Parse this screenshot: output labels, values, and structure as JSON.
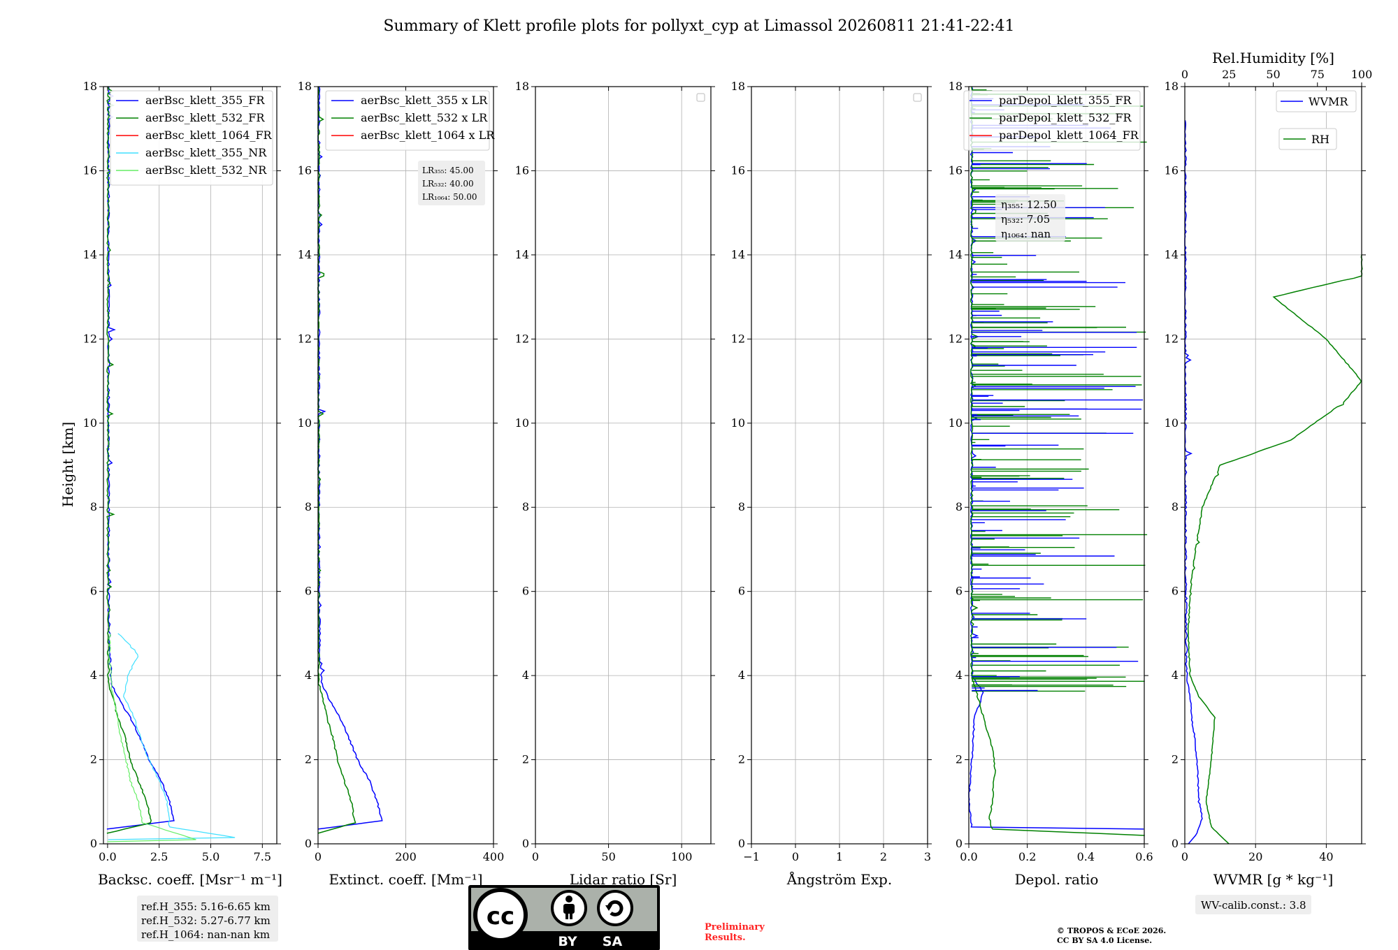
{
  "title": "Summary of Klett profile plots for pollyxt_cyp at Limassol 20260811 21:41-22:41",
  "y_label": "Height [km]",
  "colors": {
    "blue": "#0000ff",
    "green": "#008000",
    "red": "#ff0000",
    "cyan": "#40e0ff",
    "lightgreen": "#66ee66"
  },
  "chart_data": [
    {
      "type": "line",
      "id": "backscatter",
      "xlabel": "Backsc. coeff. [Msr⁻¹ m⁻¹]",
      "xlim": [
        -0.2,
        8.2
      ],
      "ylim": [
        0,
        18
      ],
      "xticks": [
        "0.0",
        "2.5",
        "5.0",
        "7.5"
      ],
      "xtick_values": [
        0,
        2.5,
        5,
        7.5
      ],
      "yticks": [
        "0",
        "2",
        "4",
        "6",
        "8",
        "10",
        "12",
        "14",
        "16",
        "18"
      ],
      "legend": [
        "aerBsc_klett_355_FR",
        "aerBsc_klett_532_FR",
        "aerBsc_klett_1064_FR",
        "aerBsc_klett_355_NR",
        "aerBsc_klett_532_NR"
      ],
      "legend_colors": [
        "blue",
        "green",
        "red",
        "cyan",
        "lightgreen"
      ],
      "legend_position": "upper-right",
      "series": [
        {
          "name": "aerBsc_klett_355_FR",
          "color": "blue",
          "points": [
            [
              0,
              0.35
            ],
            [
              3.2,
              0.55
            ],
            [
              3.0,
              1.0
            ],
            [
              2.6,
              1.5
            ],
            [
              2.0,
              2.0
            ],
            [
              1.5,
              2.6
            ],
            [
              1.1,
              3.0
            ],
            [
              0.6,
              3.4
            ],
            [
              0.2,
              3.8
            ],
            [
              0.1,
              4.5
            ],
            [
              0.05,
              6
            ],
            [
              0.05,
              10
            ],
            [
              0.05,
              14
            ],
            [
              0.05,
              18
            ]
          ]
        },
        {
          "name": "aerBsc_klett_532_FR",
          "color": "green",
          "points": [
            [
              0,
              0.25
            ],
            [
              2.1,
              0.5
            ],
            [
              1.9,
              1.0
            ],
            [
              1.5,
              1.5
            ],
            [
              1.1,
              2.0
            ],
            [
              0.8,
              2.6
            ],
            [
              0.5,
              3.0
            ],
            [
              0.25,
              3.5
            ],
            [
              0.05,
              3.8
            ],
            [
              0.02,
              6
            ],
            [
              0.02,
              10
            ],
            [
              0.02,
              14
            ],
            [
              0.02,
              18
            ]
          ]
        },
        {
          "name": "aerBsc_klett_355_NR",
          "color": "cyan",
          "points": [
            [
              0,
              0.1
            ],
            [
              6.2,
              0.15
            ],
            [
              3.0,
              0.4
            ],
            [
              2.9,
              1.0
            ],
            [
              2.5,
              1.5
            ],
            [
              2.0,
              2.0
            ],
            [
              1.6,
              2.5
            ],
            [
              1.3,
              3.0
            ],
            [
              0.8,
              3.5
            ],
            [
              1.0,
              4.0
            ],
            [
              1.5,
              4.5
            ],
            [
              0.5,
              5.0
            ]
          ]
        },
        {
          "name": "aerBsc_klett_532_NR",
          "color": "lightgreen",
          "points": [
            [
              0,
              0.05
            ],
            [
              4.3,
              0.1
            ],
            [
              1.7,
              0.5
            ],
            [
              1.5,
              1.0
            ],
            [
              1.1,
              1.5
            ],
            [
              0.9,
              2.0
            ],
            [
              0.6,
              2.6
            ],
            [
              0.4,
              3.2
            ],
            [
              0.2,
              3.7
            ],
            [
              0.1,
              4.5
            ],
            [
              0.1,
              5.0
            ]
          ]
        }
      ],
      "annotation": [
        "ref.H_355: 5.16-6.65 km",
        "ref.H_532: 5.27-6.77 km",
        "ref.H_1064: nan-nan km"
      ]
    },
    {
      "type": "line",
      "id": "extinction",
      "xlabel": "Extinct. coeff. [Mm⁻¹]",
      "xlim": [
        0,
        400
      ],
      "ylim": [
        0,
        18
      ],
      "xticks": [
        "0",
        "200",
        "400"
      ],
      "xtick_values": [
        0,
        200,
        400
      ],
      "yticks": [
        "0",
        "2",
        "4",
        "6",
        "8",
        "10",
        "12",
        "14",
        "16",
        "18"
      ],
      "legend": [
        "aerBsc_klett_355 x LR",
        "aerBsc_klett_532 x LR",
        "aerBsc_klett_1064 x LR"
      ],
      "legend_colors": [
        "blue",
        "green",
        "red"
      ],
      "legend_position": "upper-right",
      "series": [
        {
          "name": "aerBsc_klett_355 x LR",
          "color": "blue",
          "points": [
            [
              0,
              0.35
            ],
            [
              145,
              0.55
            ],
            [
              135,
              1.0
            ],
            [
              117,
              1.5
            ],
            [
              90,
              2.0
            ],
            [
              67,
              2.6
            ],
            [
              50,
              3.0
            ],
            [
              27,
              3.4
            ],
            [
              9,
              3.8
            ],
            [
              4,
              4.5
            ],
            [
              2,
              6
            ],
            [
              2,
              10
            ],
            [
              2,
              14
            ],
            [
              2,
              18
            ]
          ]
        },
        {
          "name": "aerBsc_klett_532 x LR",
          "color": "green",
          "points": [
            [
              0,
              0.25
            ],
            [
              84,
              0.5
            ],
            [
              76,
              1.0
            ],
            [
              60,
              1.5
            ],
            [
              44,
              2.0
            ],
            [
              32,
              2.6
            ],
            [
              20,
              3.0
            ],
            [
              10,
              3.5
            ],
            [
              2,
              3.8
            ],
            [
              1,
              6
            ],
            [
              1,
              10
            ],
            [
              1,
              14
            ],
            [
              1,
              18
            ]
          ]
        }
      ],
      "annotation": [
        "LR₃₅₅: 45.00",
        "LR₅₃₂: 40.00",
        "LR₁₀₆₄: 50.00"
      ]
    },
    {
      "type": "line",
      "id": "lidar-ratio",
      "xlabel": "Lidar ratio [Sr]",
      "xlim": [
        0,
        120
      ],
      "ylim": [
        0,
        18
      ],
      "xticks": [
        "0",
        "50",
        "100"
      ],
      "xtick_values": [
        0,
        50,
        100
      ],
      "yticks": [
        "0",
        "2",
        "4",
        "6",
        "8",
        "10",
        "12",
        "14",
        "16",
        "18"
      ],
      "series": []
    },
    {
      "type": "line",
      "id": "angstrom",
      "xlabel": "Ångström Exp.",
      "xlim": [
        -1,
        3
      ],
      "ylim": [
        0,
        18
      ],
      "xticks": [
        "−1",
        "0",
        "1",
        "2",
        "3"
      ],
      "xtick_values": [
        -1,
        0,
        1,
        2,
        3
      ],
      "yticks": [
        "0",
        "2",
        "4",
        "6",
        "8",
        "10",
        "12",
        "14",
        "16",
        "18"
      ],
      "series": []
    },
    {
      "type": "line",
      "id": "depol",
      "xlabel": "Depol. ratio",
      "xlim": [
        0,
        0.6
      ],
      "ylim": [
        0,
        18
      ],
      "xticks": [
        "0.0",
        "0.2",
        "0.4",
        "0.6"
      ],
      "xtick_values": [
        0,
        0.2,
        0.4,
        0.6
      ],
      "yticks": [
        "0",
        "2",
        "4",
        "6",
        "8",
        "10",
        "12",
        "14",
        "16",
        "18"
      ],
      "legend": [
        "parDepol_klett_355_FR",
        "parDepol_klett_532_FR",
        "parDepol_klett_1064_FR"
      ],
      "legend_colors": [
        "blue",
        "green",
        "red"
      ],
      "legend_position": "upper-right",
      "series": [
        {
          "name": "parDepol_klett_355_FR",
          "color": "blue",
          "points": [
            [
              0.6,
              0.35
            ],
            [
              0.01,
              0.4
            ],
            [
              0.0,
              1.0
            ],
            [
              0.01,
              2.0
            ],
            [
              0.02,
              3.0
            ],
            [
              0.05,
              3.6
            ],
            [
              0.01,
              4.0
            ],
            [
              0.01,
              6
            ],
            [
              0.01,
              10
            ],
            [
              0.01,
              14
            ],
            [
              0.01,
              18
            ]
          ]
        },
        {
          "name": "parDepol_klett_532_FR",
          "color": "green",
          "points": [
            [
              0.6,
              0.2
            ],
            [
              0.08,
              0.35
            ],
            [
              0.07,
              0.6
            ],
            [
              0.08,
              1.0
            ],
            [
              0.09,
              1.8
            ],
            [
              0.08,
              2.3
            ],
            [
              0.05,
              3.0
            ],
            [
              0.03,
              3.5
            ],
            [
              0.01,
              4.0
            ],
            [
              0.01,
              6
            ],
            [
              0.01,
              10
            ],
            [
              0.01,
              14
            ],
            [
              0.01,
              18
            ]
          ]
        }
      ],
      "spikes": {
        "blue_max": 0.6,
        "green_max": 0.6,
        "from": 3.5,
        "to": 18
      },
      "annotation": [
        "η₃₅₅: 12.50",
        "η₅₃₂: 7.05",
        "η₁₀₆₄: nan"
      ]
    },
    {
      "type": "line",
      "id": "wvmr",
      "xlabel": "WVMR [g * kg⁻¹]",
      "xlim": [
        0,
        50
      ],
      "ylim": [
        0,
        18
      ],
      "xticks": [
        "0",
        "20",
        "40"
      ],
      "xtick_values": [
        0,
        20,
        40
      ],
      "yticks": [
        "0",
        "2",
        "4",
        "6",
        "8",
        "10",
        "12",
        "14",
        "16",
        "18"
      ],
      "top_xlabel": "Rel.Humidity [%]",
      "top_xlim": [
        0,
        100
      ],
      "top_xticks": [
        "0",
        "25",
        "50",
        "75",
        "100"
      ],
      "top_xtick_values": [
        0,
        25,
        50,
        75,
        100
      ],
      "legend": [
        "WVMR",
        "RH"
      ],
      "legend_colors": [
        "blue",
        "green"
      ],
      "legend_position": "upper-right",
      "series": [
        {
          "name": "WVMR",
          "color": "blue",
          "points": [
            [
              1,
              0
            ],
            [
              3,
              0.2
            ],
            [
              5,
              0.6
            ],
            [
              4,
              1.0
            ],
            [
              3.5,
              2.0
            ],
            [
              2,
              3.0
            ],
            [
              1.5,
              3.5
            ],
            [
              0.5,
              4.0
            ],
            [
              0.3,
              6
            ],
            [
              0.2,
              8
            ],
            [
              0.2,
              10
            ],
            [
              0.1,
              12
            ],
            [
              0.1,
              14
            ],
            [
              0.1,
              17.2
            ]
          ]
        },
        {
          "name": "RH",
          "color": "green",
          "axis": "top",
          "points": [
            [
              25,
              0
            ],
            [
              15,
              0.4
            ],
            [
              12,
              1.0
            ],
            [
              15,
              2.0
            ],
            [
              17,
              3.0
            ],
            [
              8,
              3.5
            ],
            [
              3,
              4.0
            ],
            [
              2,
              5
            ],
            [
              3,
              6
            ],
            [
              6,
              7
            ],
            [
              10,
              8
            ],
            [
              20,
              9
            ],
            [
              60,
              9.6
            ],
            [
              90,
              10.5
            ],
            [
              100,
              11
            ],
            [
              80,
              12
            ],
            [
              50,
              13
            ],
            [
              100,
              13.5
            ],
            [
              100,
              14
            ]
          ]
        }
      ],
      "annotation": [
        "WV-calib.const.: 3.8"
      ]
    }
  ],
  "badge": {
    "cc": "cc",
    "by": "BY",
    "sa": "SA"
  },
  "preliminary": [
    "Preliminary",
    "Results."
  ],
  "copyright": [
    "© TROPOS & ECoE 2026.",
    "CC BY SA 4.0 License."
  ]
}
